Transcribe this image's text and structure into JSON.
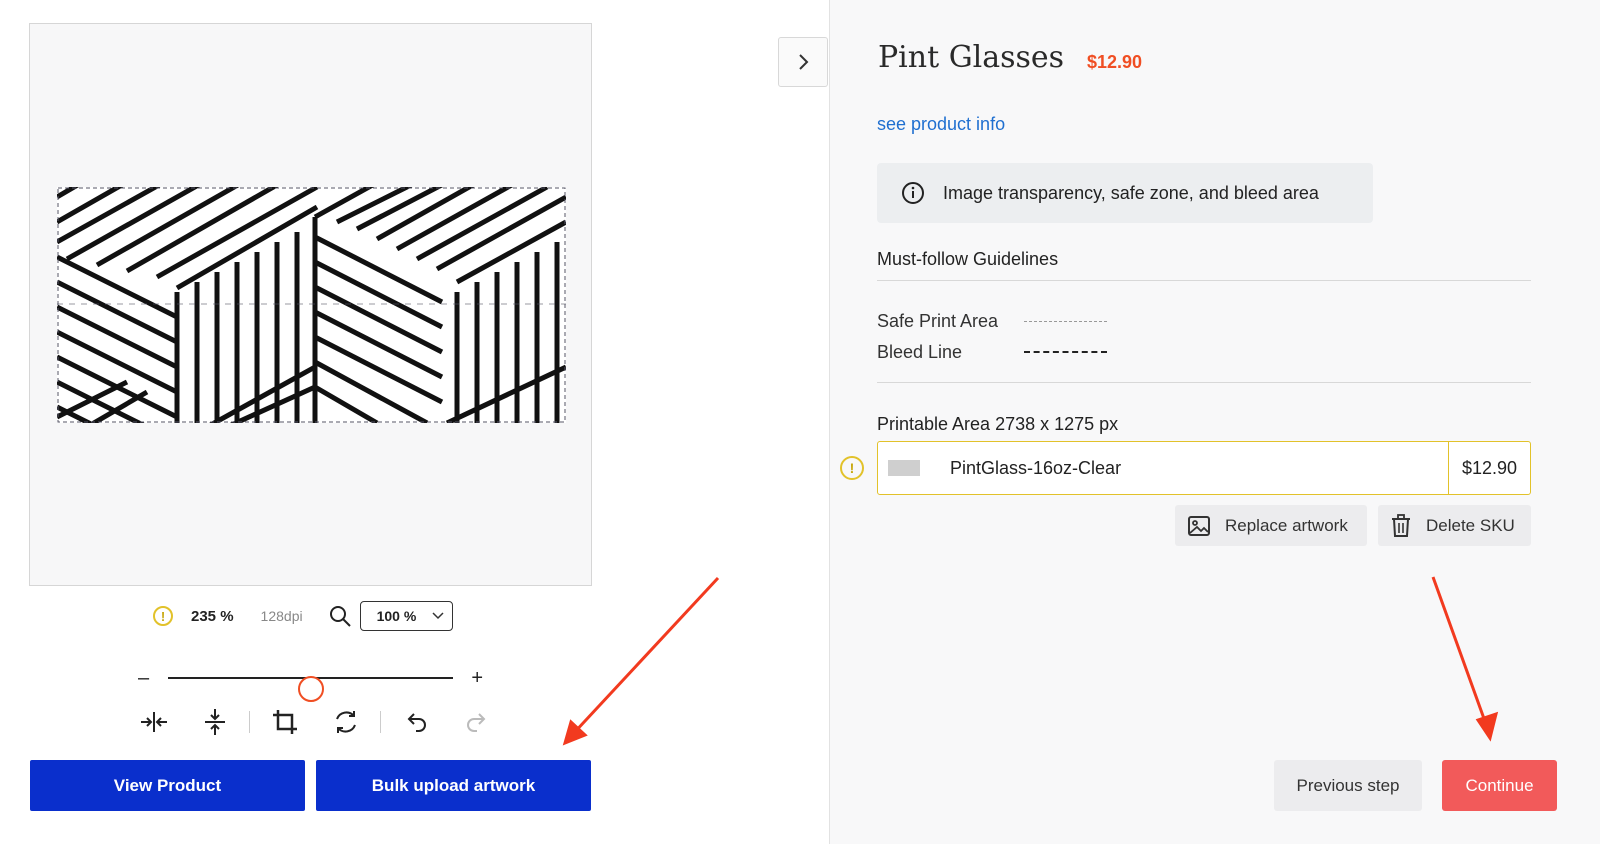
{
  "editor": {
    "zoom_percent": "235 %",
    "dpi": "128dpi",
    "zoom_select_value": "100 %",
    "slider_minus": "–",
    "slider_plus": "+",
    "slider_value": 0.5,
    "buttons": {
      "view_product": "View Product",
      "bulk_upload": "Bulk upload artwork"
    },
    "tool_icons": [
      "flip-horizontal-icon",
      "flip-vertical-icon",
      "crop-icon",
      "rotate-icon",
      "undo-icon",
      "redo-icon"
    ]
  },
  "product": {
    "title": "Pint Glasses",
    "price": "$12.90",
    "info_link": "see product info",
    "info_box_text": "Image transparency, safe zone, and bleed area",
    "guidelines_title": "Must-follow Guidelines",
    "legend": {
      "safe": "Safe Print Area",
      "bleed": "Bleed Line"
    },
    "printable_area": "Printable Area 2738 x 1275 px",
    "sku": {
      "name": "PintGlass-16oz-Clear",
      "price": "$12.90"
    },
    "actions": {
      "replace": "Replace artwork",
      "delete": "Delete SKU"
    },
    "nav": {
      "previous": "Previous step",
      "continue": "Continue"
    }
  },
  "colors": {
    "primary": "#0a2fcc",
    "accent": "#f04e23",
    "continue": "#f25a5a",
    "warning": "#e2c22a",
    "link": "#1f6fd0"
  }
}
